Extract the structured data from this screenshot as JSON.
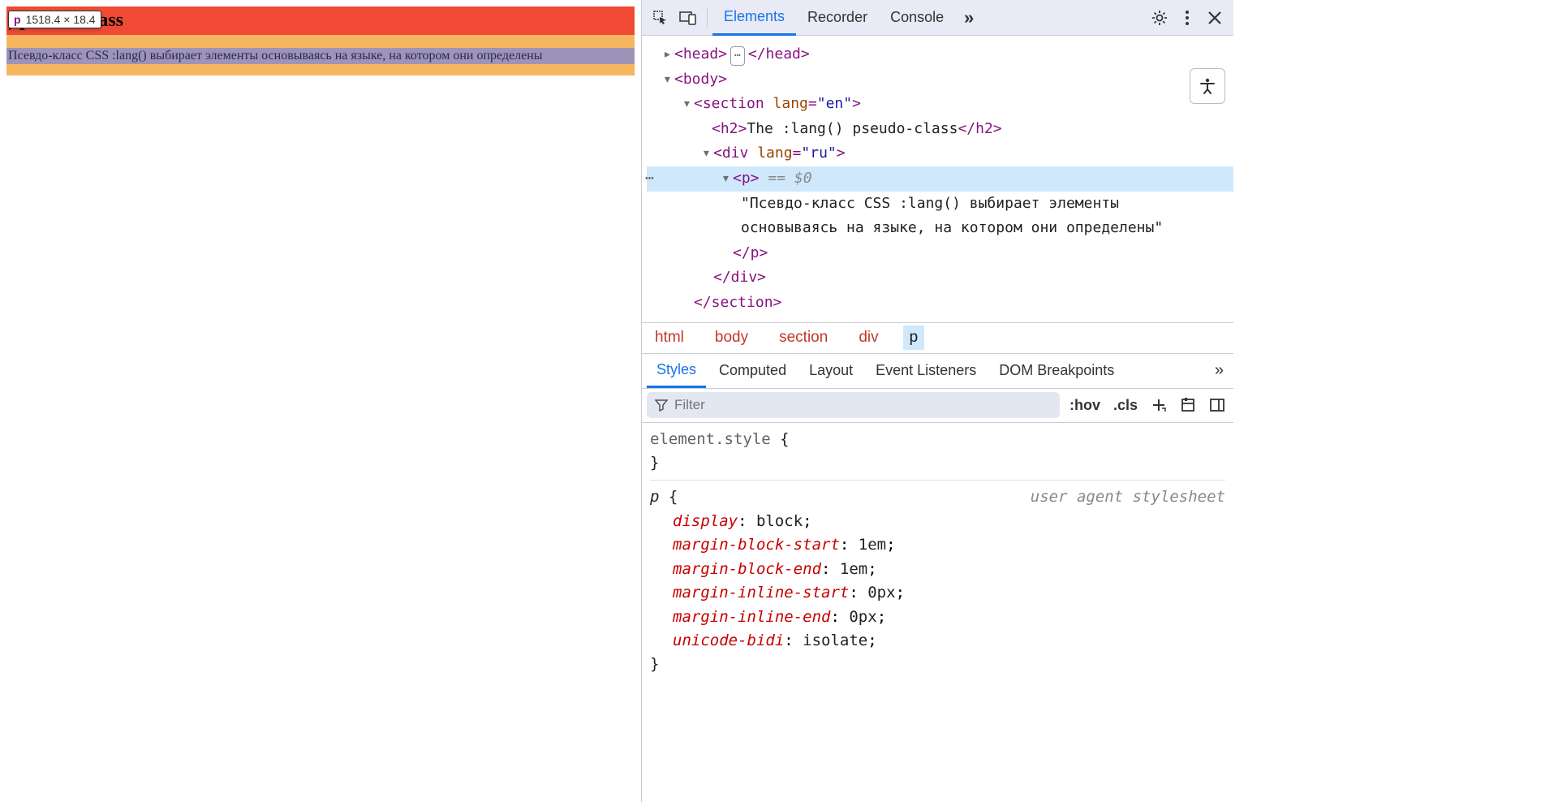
{
  "tooltip": {
    "tag": "p",
    "dims": "1518.4 × 18.4"
  },
  "rendered": {
    "h2_visible": ") pseudo-class",
    "p_text": "Псевдо-класс CSS :lang() выбирает элементы основываясь на языке, на котором они определены"
  },
  "devtools": {
    "tabs": {
      "elements": "Elements",
      "recorder": "Recorder",
      "console": "Console"
    },
    "dom": {
      "head_open": "<head>",
      "head_close": "</head>",
      "body_open": "<body>",
      "section_open_a": "<section ",
      "section_lang_attr": "lang",
      "section_lang_val": "\"en\"",
      "section_open_b": ">",
      "h2_open": "<h2>",
      "h2_text": "The :lang() pseudo-class",
      "h2_close": "</h2>",
      "div_open_a": "<div ",
      "div_lang_attr": "lang",
      "div_lang_val": "\"ru\"",
      "div_open_b": ">",
      "p_open": "<p>",
      "eq0": " == $0",
      "p_text": "\"Псевдо-класс CSS :lang() выбирает элементы основываясь на языке, на котором они определены\"",
      "p_close": "</p>",
      "div_close": "</div>",
      "section_close": "</section>"
    },
    "breadcrumb": {
      "html": "html",
      "body": "body",
      "section": "section",
      "div": "div",
      "p": "p"
    },
    "sub_tabs": {
      "styles": "Styles",
      "computed": "Computed",
      "layout": "Layout",
      "event": "Event Listeners",
      "dom_bp": "DOM Breakpoints"
    },
    "filter": {
      "placeholder": "Filter",
      "hov": ":hov",
      "cls": ".cls"
    },
    "styles": {
      "element_style_selector": "element.style",
      "p_selector": "p",
      "ua_label": "user agent stylesheet",
      "props": {
        "display_n": "display",
        "display_v": "block",
        "mbs_n": "margin-block-start",
        "mbs_v": "1em",
        "mbe_n": "margin-block-end",
        "mbe_v": "1em",
        "mis_n": "margin-inline-start",
        "mis_v": "0px",
        "mie_n": "margin-inline-end",
        "mie_v": "0px",
        "ub_n": "unicode-bidi",
        "ub_v": "isolate"
      }
    }
  }
}
